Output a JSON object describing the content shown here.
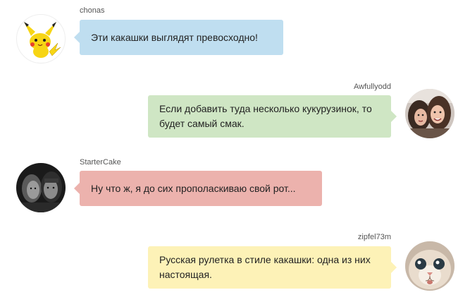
{
  "messages": [
    {
      "user": "chonas",
      "text": "Эти какашки выглядят превосходно!",
      "avatar_icon": "pikachu-icon",
      "bubble_color": "#bfdef0"
    },
    {
      "user": "Awfullyodd",
      "text": "Если добавить туда несколько кукурузинок, то будет самый смак.",
      "avatar_icon": "girls-photo-icon",
      "bubble_color": "#cfe6c4"
    },
    {
      "user": "StarterCake",
      "text": "Ну что ж, я до сих прополаскиваю свой рот...",
      "avatar_icon": "men-photo-icon",
      "bubble_color": "#ecb2ad"
    },
    {
      "user": "zipfel73m",
      "text": "Русская рулетка в стиле какашки: одна из них настоящая.",
      "avatar_icon": "cat-photo-icon",
      "bubble_color": "#fdf2b7"
    }
  ]
}
